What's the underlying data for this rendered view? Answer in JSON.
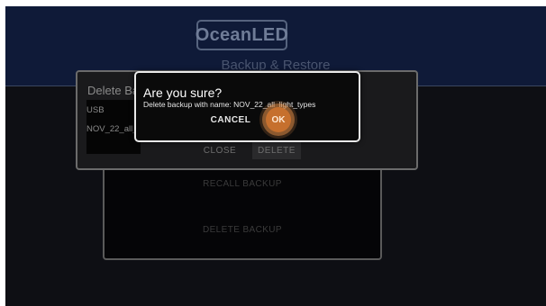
{
  "header": {
    "logo_text": "OceanLED",
    "page_title": "Backup & Restore"
  },
  "menu": {
    "items": [
      {
        "label": "RECALL BACKUP"
      },
      {
        "label": "DELETE BACKUP"
      }
    ]
  },
  "delete_dialog": {
    "title": "Delete Backup",
    "backups": [
      {
        "name": "USB"
      },
      {
        "name": "NOV_22_all_light_types"
      }
    ],
    "close_label": "CLOSE",
    "delete_label": "DELETE"
  },
  "confirm_dialog": {
    "title": "Are you sure?",
    "message": "Delete backup with name: NOV_22_all_light_types",
    "cancel_label": "CANCEL",
    "ok_label": "OK"
  },
  "colors": {
    "header_bg": "#0f1a38",
    "accent": "#c6702e",
    "dialog_border": "#e9e9e9"
  }
}
